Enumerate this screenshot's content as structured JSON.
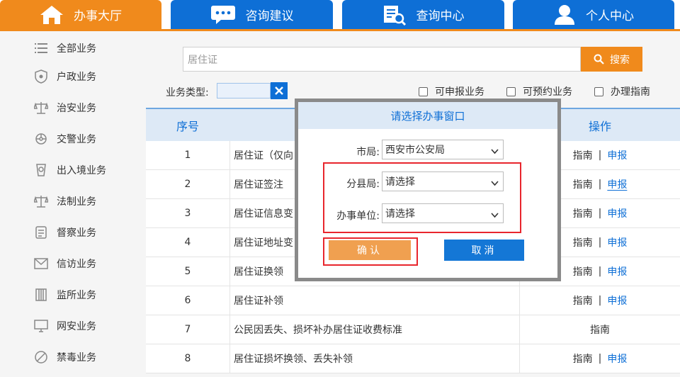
{
  "nav": {
    "tabs": [
      {
        "label": "办事大厅",
        "icon": "home-icon",
        "active": true
      },
      {
        "label": "咨询建议",
        "icon": "chat-icon",
        "active": false
      },
      {
        "label": "查询中心",
        "icon": "search-doc-icon",
        "active": false
      },
      {
        "label": "个人中心",
        "icon": "user-icon",
        "active": false
      }
    ],
    "colors": {
      "active": "#f08a1c",
      "inactive": "#0e6fd6"
    }
  },
  "sidebar": {
    "items": [
      {
        "label": "全部业务",
        "icon": "list-icon"
      },
      {
        "label": "户政业务",
        "icon": "shield-icon"
      },
      {
        "label": "治安业务",
        "icon": "scales-icon"
      },
      {
        "label": "交警业务",
        "icon": "traffic-icon"
      },
      {
        "label": "出入境业务",
        "icon": "passport-icon"
      },
      {
        "label": "法制业务",
        "icon": "law-scales-icon"
      },
      {
        "label": "督察业务",
        "icon": "badge-icon"
      },
      {
        "label": "信访业务",
        "icon": "mail-icon"
      },
      {
        "label": "监所业务",
        "icon": "building-icon"
      },
      {
        "label": "网安业务",
        "icon": "monitor-icon"
      },
      {
        "label": "禁毒业务",
        "icon": "no-drug-icon"
      }
    ]
  },
  "search": {
    "value": "居住证",
    "button_label": "搜索"
  },
  "filters": {
    "type_label": "业务类型:",
    "checkboxes": [
      {
        "label": "可申报业务",
        "checked": false
      },
      {
        "label": "可预约业务",
        "checked": false
      },
      {
        "label": "办理指南",
        "checked": false
      }
    ]
  },
  "table": {
    "headers": {
      "num": "序号",
      "ops": "操作"
    },
    "op_guide": "指南",
    "op_sep": "|",
    "op_apply": "申报",
    "rows": [
      {
        "num": "1",
        "name": "居住证（仅向",
        "apply": true
      },
      {
        "num": "2",
        "name": "居住证签注",
        "apply": true
      },
      {
        "num": "3",
        "name": "居住证信息变",
        "apply": true
      },
      {
        "num": "4",
        "name": "居住证地址变",
        "apply": true
      },
      {
        "num": "5",
        "name": "居住证换领",
        "apply": true
      },
      {
        "num": "6",
        "name": "居住证补领",
        "apply": true
      },
      {
        "num": "7",
        "name": "公民因丢失、损坏补办居住证收费标准",
        "apply": false
      },
      {
        "num": "8",
        "name": "居住证损坏换领、丢失补领",
        "apply": true
      }
    ]
  },
  "modal": {
    "title": "请选择办事窗口",
    "fields": [
      {
        "label": "市局:",
        "value": "西安市公安局"
      },
      {
        "label": "分县局:",
        "value": "请选择"
      },
      {
        "label": "办事单位:",
        "value": "请选择"
      }
    ],
    "confirm_label": "确认",
    "cancel_label": "取消"
  }
}
